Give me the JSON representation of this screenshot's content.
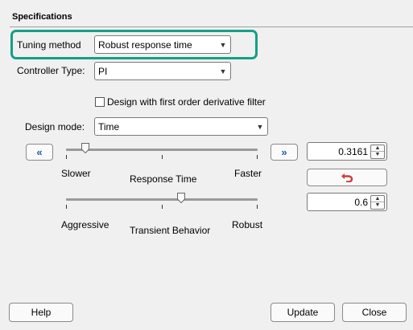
{
  "section": {
    "title": "Specifications"
  },
  "tuning_method": {
    "label": "Tuning method",
    "value": "Robust response time"
  },
  "controller_type": {
    "label": "Controller Type:",
    "value": "PI"
  },
  "derivative_filter": {
    "label": "Design with first order derivative filter",
    "checked": false
  },
  "design_mode": {
    "label": "Design mode:",
    "value": "Time"
  },
  "response_time": {
    "label": "Response Time",
    "left_label": "Slower",
    "right_label": "Faster",
    "value": "0.3161",
    "slider_fraction": 0.1
  },
  "transient_behavior": {
    "label": "Transient Behavior",
    "left_label": "Aggressive",
    "right_label": "Robust",
    "value": "0.6",
    "slider_fraction": 0.6
  },
  "nav": {
    "left_glyph": "«",
    "right_glyph": "»"
  },
  "buttons": {
    "help": "Help",
    "update": "Update",
    "close": "Close"
  },
  "icons": {
    "reset": "undo-arrow-icon",
    "dropdown": "chevron-down-icon",
    "spin_up": "spin-up-icon",
    "spin_down": "spin-down-icon"
  },
  "colors": {
    "highlight": "#14a085",
    "reset_icon": "#d03a3a",
    "nav_arrow": "#1f5fa8"
  }
}
